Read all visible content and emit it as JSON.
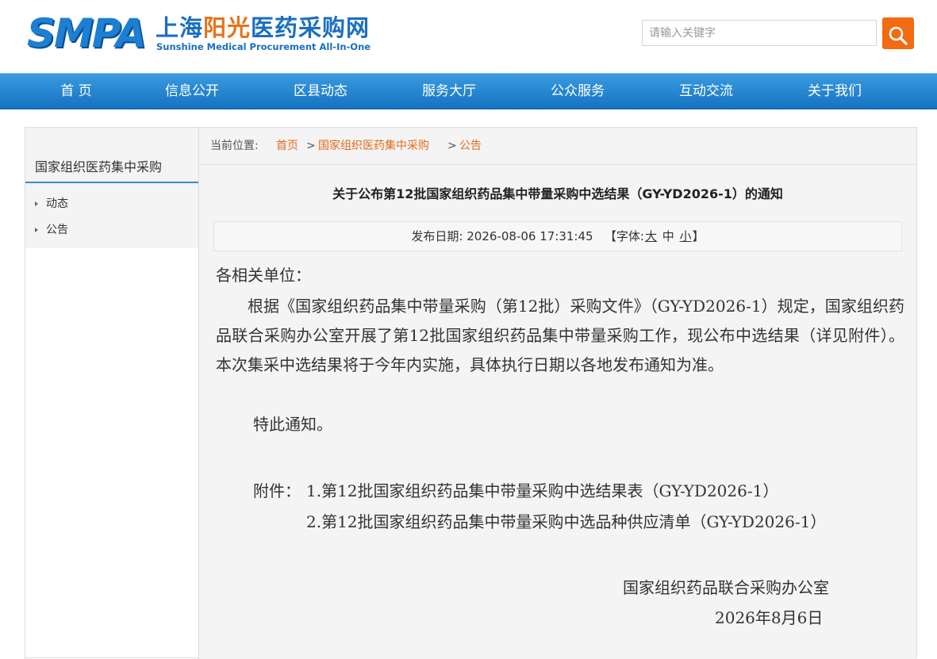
{
  "header": {
    "logo_mark": "SMPA",
    "logo_cn_prefix": "上海",
    "logo_cn_accent": "阳光",
    "logo_cn_suffix": "医药采购网",
    "logo_en": "Sunshine Medical Procurement All-In-One",
    "search_placeholder": "请输入关键字"
  },
  "nav": {
    "items": [
      "首 页",
      "信息公开",
      "区县动态",
      "服务大厅",
      "公众服务",
      "互动交流",
      "关于我们"
    ]
  },
  "sidebar": {
    "title": "国家组织医药集中采购",
    "links": [
      "动态",
      "公告"
    ]
  },
  "breadcrumb": {
    "label": "当前位置:",
    "items": [
      "首页",
      "国家组织医药集中采购",
      "公告"
    ],
    "separator": ">"
  },
  "article": {
    "title": "关于公布第12批国家组织药品集中带量采购中选结果（GY-YD2026-1）的通知",
    "date_label": "发布日期:",
    "date": "2026-08-06 17:31:45",
    "font_prefix": "【字体:",
    "font_large": "大",
    "font_medium": "中",
    "font_small": "小",
    "font_suffix": "】",
    "salutation": "各相关单位：",
    "paragraph": "根据《国家组织药品集中带量采购（第12批）采购文件》（GY-YD2026-1）规定，国家组织药品联合采购办公室开展了第12批国家组织药品集中带量采购工作，现公布中选结果（详见附件）。本次集采中选结果将于今年内实施，具体执行日期以各地发布通知为准。",
    "closing": "特此通知。",
    "attachment_label": "附件：",
    "attachments": [
      "1.第12批国家组织药品集中带量采购中选结果表（GY-YD2026-1）",
      "2.第12批国家组织药品集中带量采购中选品种供应清单（GY-YD2026-1）"
    ],
    "signature_org": "国家组织药品联合采购办公室",
    "signature_date": "2026年8月6日"
  }
}
